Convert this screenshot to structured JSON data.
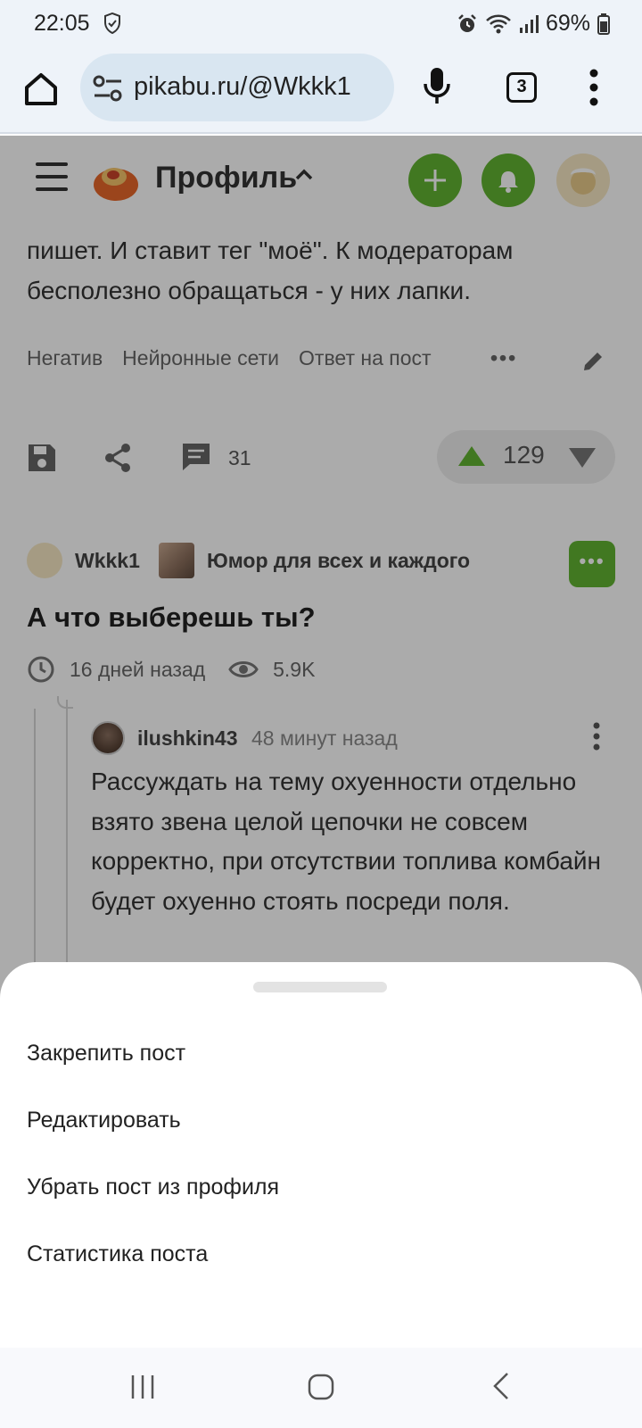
{
  "status_bar": {
    "time": "22:05",
    "battery": "69%",
    "icons": [
      "shield-icon",
      "alarm-icon",
      "wifi-icon",
      "signal-icon",
      "battery-icon"
    ]
  },
  "browser": {
    "url": "pikabu.ru/@Wkkk1",
    "tab_count": "3",
    "icons": [
      "home-icon",
      "site-settings-icon",
      "mic-icon",
      "tabs-icon",
      "more-vert-icon"
    ]
  },
  "site_header": {
    "title": "Профиль",
    "accent_color": "#62b332"
  },
  "post1": {
    "text_partial": "пишет. И ставит тег \"моё\". К модераторам бесполезно обращаться - у них лапки.",
    "tags": [
      "Негатив",
      "Нейронные сети",
      "Ответ на пост"
    ],
    "tags_more": "•••",
    "comments_count": "31",
    "rating": "129"
  },
  "post2": {
    "author": "Wkkk1",
    "community": "Юмор для всех и каждого",
    "more_label": "•••",
    "title": "А что выберешь ты?",
    "time": "16 дней назад",
    "views": "5.9K",
    "comment": {
      "author": "ilushkin43",
      "time": "48 минут назад",
      "text": "Рассуждать на тему охуенности отдельно взято звена целой цепочки не совсем корректно, при отсутствии топлива комбайн будет охуенно стоять посреди поля."
    }
  },
  "sheet": {
    "items": [
      "Закрепить пост",
      "Редактировать",
      "Убрать пост из профиля",
      "Статистика поста"
    ]
  },
  "nav": {
    "icons": [
      "recents-icon",
      "home-button-icon",
      "back-icon"
    ]
  }
}
